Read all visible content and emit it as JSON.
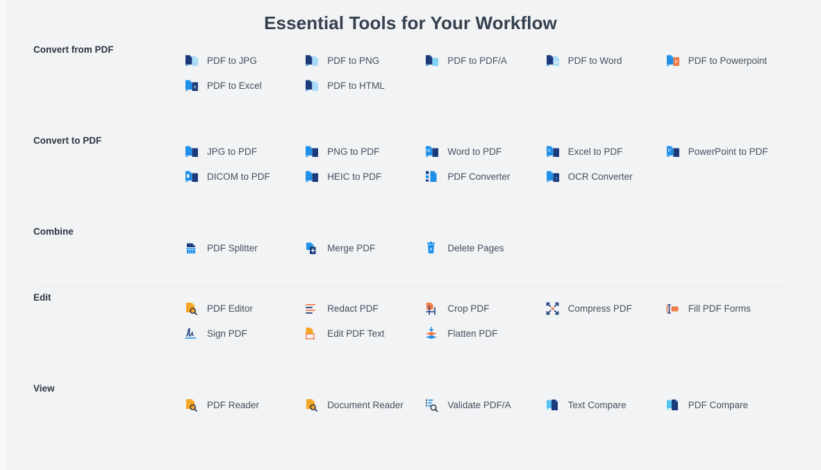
{
  "page": {
    "title": "Essential Tools for Your Workflow",
    "background_color": "#f1f3f5",
    "title_color": "#35404e",
    "label_color": "#44505e",
    "accent_navy": "#1b3a7a",
    "accent_blue": "#1f8fe8",
    "accent_light_blue": "#6ec6f5",
    "accent_orange": "#f07a45",
    "accent_amber": "#f5a623",
    "divider_color": "#e8eaec"
  },
  "sections": [
    {
      "label": "Convert from PDF",
      "tools": [
        {
          "name": "pdf-to-jpg",
          "label": "PDF to JPG",
          "icon": "doc-pair-navy-lightblue"
        },
        {
          "name": "pdf-to-png",
          "label": "PDF to PNG",
          "icon": "doc-pair-navy-lightblue"
        },
        {
          "name": "pdf-to-pdfa",
          "label": "PDF to PDF/A",
          "icon": "doc-pair-navy-cyan"
        },
        {
          "name": "pdf-to-word",
          "label": "PDF to Word",
          "icon": "doc-pair-navy-lightblue-w"
        },
        {
          "name": "pdf-to-powerpoint",
          "label": "PDF to Powerpoint",
          "icon": "doc-pair-blue-orange-p"
        },
        {
          "name": "pdf-to-excel",
          "label": "PDF to Excel",
          "icon": "doc-pair-blue-navy-x"
        },
        {
          "name": "pdf-to-html",
          "label": "PDF to HTML",
          "icon": "doc-pair-navy-lightblue"
        }
      ]
    },
    {
      "label": "Convert to PDF",
      "tools": [
        {
          "name": "jpg-to-pdf",
          "label": "JPG to PDF",
          "icon": "doc-pair-blue-navy"
        },
        {
          "name": "png-to-pdf",
          "label": "PNG to PDF",
          "icon": "doc-pair-blue-navy"
        },
        {
          "name": "word-to-pdf",
          "label": "Word to PDF",
          "icon": "doc-pair-blue-navy-w"
        },
        {
          "name": "excel-to-pdf",
          "label": "Excel to PDF",
          "icon": "doc-pair-blue-navy-x"
        },
        {
          "name": "powerpoint-to-pdf",
          "label": "PowerPoint to PDF",
          "icon": "doc-pair-blue-navy-p"
        },
        {
          "name": "dicom-to-pdf",
          "label": "DICOM to PDF",
          "icon": "doc-pair-blue-navy-d"
        },
        {
          "name": "heic-to-pdf",
          "label": "HEIC to PDF",
          "icon": "doc-pair-blue-navy"
        },
        {
          "name": "pdf-converter",
          "label": "PDF Converter",
          "icon": "tiles-converter"
        },
        {
          "name": "ocr-converter",
          "label": "OCR Converter",
          "icon": "doc-pair-blue-navy-t"
        }
      ]
    },
    {
      "label": "Combine",
      "tools": [
        {
          "name": "pdf-splitter",
          "label": "PDF Splitter",
          "icon": "splitter"
        },
        {
          "name": "merge-pdf",
          "label": "Merge PDF",
          "icon": "merge-plus"
        },
        {
          "name": "delete-pages",
          "label": "Delete Pages",
          "icon": "trash-x"
        }
      ]
    },
    {
      "label": "Edit",
      "tools": [
        {
          "name": "pdf-editor",
          "label": "PDF Editor",
          "icon": "doc-amber-magnifier"
        },
        {
          "name": "redact-pdf",
          "label": "Redact PDF",
          "icon": "redact-lines"
        },
        {
          "name": "crop-pdf",
          "label": "Crop PDF",
          "icon": "crop-marks"
        },
        {
          "name": "compress-pdf",
          "label": "Compress PDF",
          "icon": "compress-arrows"
        },
        {
          "name": "fill-pdf-forms",
          "label": "Fill PDF Forms",
          "icon": "form-field-cursor"
        },
        {
          "name": "sign-pdf",
          "label": "Sign PDF",
          "icon": "signature"
        },
        {
          "name": "edit-pdf-text",
          "label": "Edit PDF Text",
          "icon": "doc-amber-textbox"
        },
        {
          "name": "flatten-pdf",
          "label": "Flatten PDF",
          "icon": "flatten-layers"
        }
      ]
    },
    {
      "label": "View",
      "tools": [
        {
          "name": "pdf-reader",
          "label": "PDF Reader",
          "icon": "doc-amber-magnifier"
        },
        {
          "name": "document-reader",
          "label": "Document Reader",
          "icon": "doc-amber-magnifier"
        },
        {
          "name": "validate-pdfa",
          "label": "Validate PDF/A",
          "icon": "validate-magnifier"
        },
        {
          "name": "text-compare",
          "label": "Text Compare",
          "icon": "compare-docs"
        },
        {
          "name": "pdf-compare",
          "label": "PDF Compare",
          "icon": "compare-docs"
        }
      ]
    }
  ]
}
